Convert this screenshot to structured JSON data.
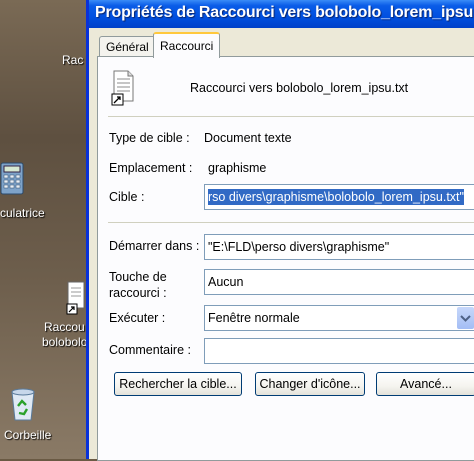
{
  "window": {
    "title": "Propriétés de Raccourci vers bolobolo_lorem_ipsu.txt"
  },
  "tabs": [
    {
      "label": "Général"
    },
    {
      "label": "Raccourci"
    }
  ],
  "shortcut": {
    "name": "Raccourci vers bolobolo_lorem_ipsu.txt",
    "type_label": "Type de cible :",
    "type_value": "Document texte",
    "location_label": "Emplacement :",
    "location_value": "graphisme",
    "target_label": "Cible :",
    "target_value": "rso divers\\graphisme\\bolobolo_lorem_ipsu.txt\"",
    "start_label": "Démarrer dans :",
    "start_value": "\"E:\\FLD\\perso divers\\graphisme\"",
    "hotkey_label_line1": "Touche de",
    "hotkey_label_line2": "raccourci :",
    "hotkey_value": "Aucun",
    "run_label": "Exécuter :",
    "run_value": "Fenêtre normale",
    "comment_label": "Commentaire :",
    "comment_value": ""
  },
  "buttons": {
    "find_target": "Rechercher la cible...",
    "change_icon": "Changer d'icône...",
    "advanced": "Avancé..."
  },
  "desktop": {
    "partial_label_top": "Rac",
    "calculator_label": "culatrice",
    "shortcut_label_line1": "Raccou",
    "shortcut_label_line2": "bolobolo",
    "recycle_label": "Corbeille"
  },
  "icons": {
    "document": "text-file-shortcut-icon",
    "calculator": "calculator-icon",
    "recycle": "recycle-bin-icon",
    "combo": "chevron-down-icon"
  }
}
